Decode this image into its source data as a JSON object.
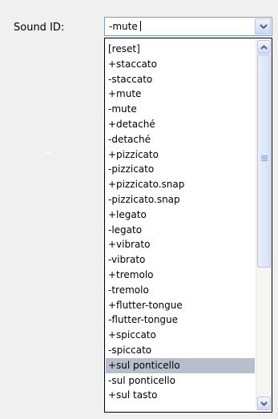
{
  "form": {
    "sound_id_label": "Sound ID:",
    "combo_value": "-mute"
  },
  "dropdown": {
    "items": [
      {
        "label": "[reset]"
      },
      {
        "label": "+staccato"
      },
      {
        "label": "-staccato"
      },
      {
        "label": "+mute"
      },
      {
        "label": "-mute"
      },
      {
        "label": "+detaché"
      },
      {
        "label": "-detaché"
      },
      {
        "label": "+pizzicato"
      },
      {
        "label": "-pizzicato"
      },
      {
        "label": "+pizzicato.snap"
      },
      {
        "label": "-pizzicato.snap"
      },
      {
        "label": "+legato"
      },
      {
        "label": "-legato"
      },
      {
        "label": "+vibrato"
      },
      {
        "label": "-vibrato"
      },
      {
        "label": "+tremolo"
      },
      {
        "label": "-tremolo"
      },
      {
        "label": "+flutter-tongue"
      },
      {
        "label": "-flutter-tongue"
      },
      {
        "label": "+spiccato"
      },
      {
        "label": "-spiccato"
      },
      {
        "label": "+sul ponticello"
      },
      {
        "label": "-sul ponticello"
      },
      {
        "label": "+sul tasto"
      }
    ],
    "selected_index": 21
  },
  "icons": {
    "combo_button": "chevron-down-icon",
    "scroll_up": "chevron-up-icon",
    "scroll_down": "chevron-down-icon",
    "thumb_grip": "grip-icon"
  },
  "colors": {
    "background": "#f0f0f0",
    "selection": "#b8bfcc",
    "combo_border": "#7f9db9"
  }
}
